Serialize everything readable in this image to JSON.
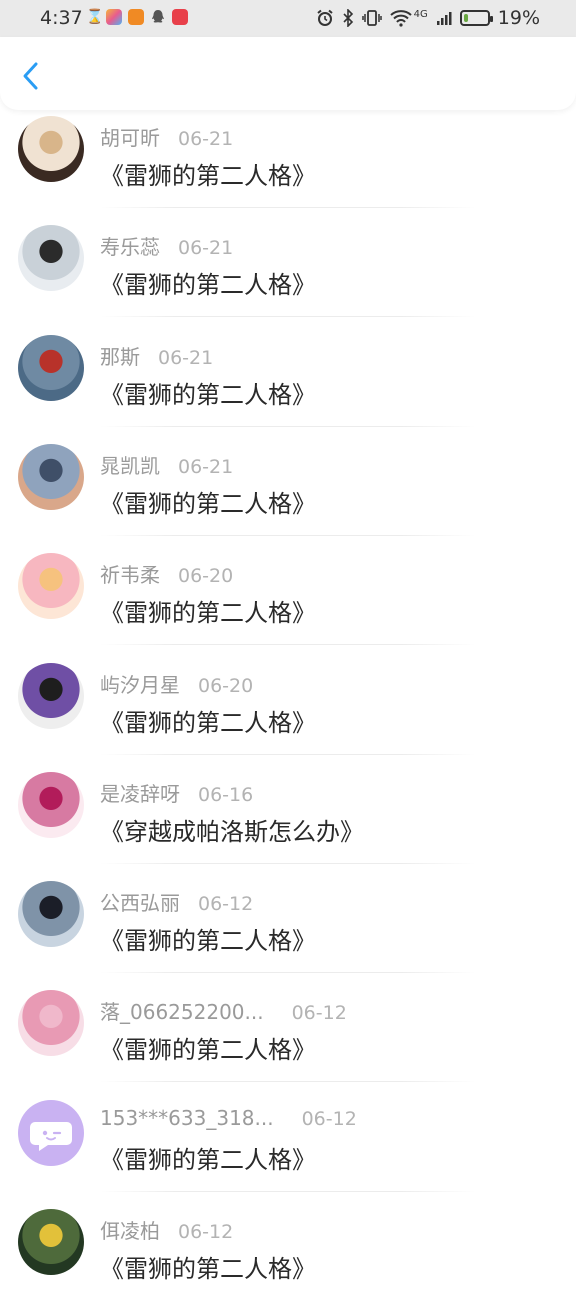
{
  "status_bar": {
    "time": "4:37",
    "battery_percent": "19%",
    "battery_level": 0.19,
    "network_label": "4G",
    "icons": [
      "hourglass-icon",
      "app-icon",
      "video-app-icon",
      "qq-icon",
      "app-icon",
      "alarm-icon",
      "bluetooth-icon",
      "vibrate-icon",
      "wifi-icon",
      "signal-icon",
      "battery-icon"
    ]
  },
  "header": {
    "back_icon": "chevron-left-icon",
    "accent_color": "#2a9df4"
  },
  "items": [
    {
      "name": "胡可昕",
      "date": "06-21",
      "title": "《雷狮的第二人格》",
      "avatar": "avatar-photo"
    },
    {
      "name": "寿乐蕊",
      "date": "06-21",
      "title": "《雷狮的第二人格》",
      "avatar": "avatar-photo"
    },
    {
      "name": "那斯",
      "date": "06-21",
      "title": "《雷狮的第二人格》",
      "avatar": "avatar-photo"
    },
    {
      "name": "晁凯凯",
      "date": "06-21",
      "title": "《雷狮的第二人格》",
      "avatar": "avatar-photo"
    },
    {
      "name": "祈韦柔",
      "date": "06-20",
      "title": "《雷狮的第二人格》",
      "avatar": "avatar-photo"
    },
    {
      "name": "屿汐月星",
      "date": "06-20",
      "title": "《雷狮的第二人格》",
      "avatar": "avatar-photo"
    },
    {
      "name": "是凌辞呀",
      "date": "06-16",
      "title": "《穿越成帕洛斯怎么办》",
      "avatar": "avatar-photo"
    },
    {
      "name": "公西弘丽",
      "date": "06-12",
      "title": "《雷狮的第二人格》",
      "avatar": "avatar-photo"
    },
    {
      "name": "落_066252200...",
      "date": "06-12",
      "title": "《雷狮的第二人格》",
      "avatar": "avatar-photo"
    },
    {
      "name": "153***633_318...",
      "date": "06-12",
      "title": "《雷狮的第二人格》",
      "avatar": "chat-bubble-icon"
    },
    {
      "name": "佴凌柏",
      "date": "06-12",
      "title": "《雷狮的第二人格》",
      "avatar": "avatar-photo"
    }
  ]
}
